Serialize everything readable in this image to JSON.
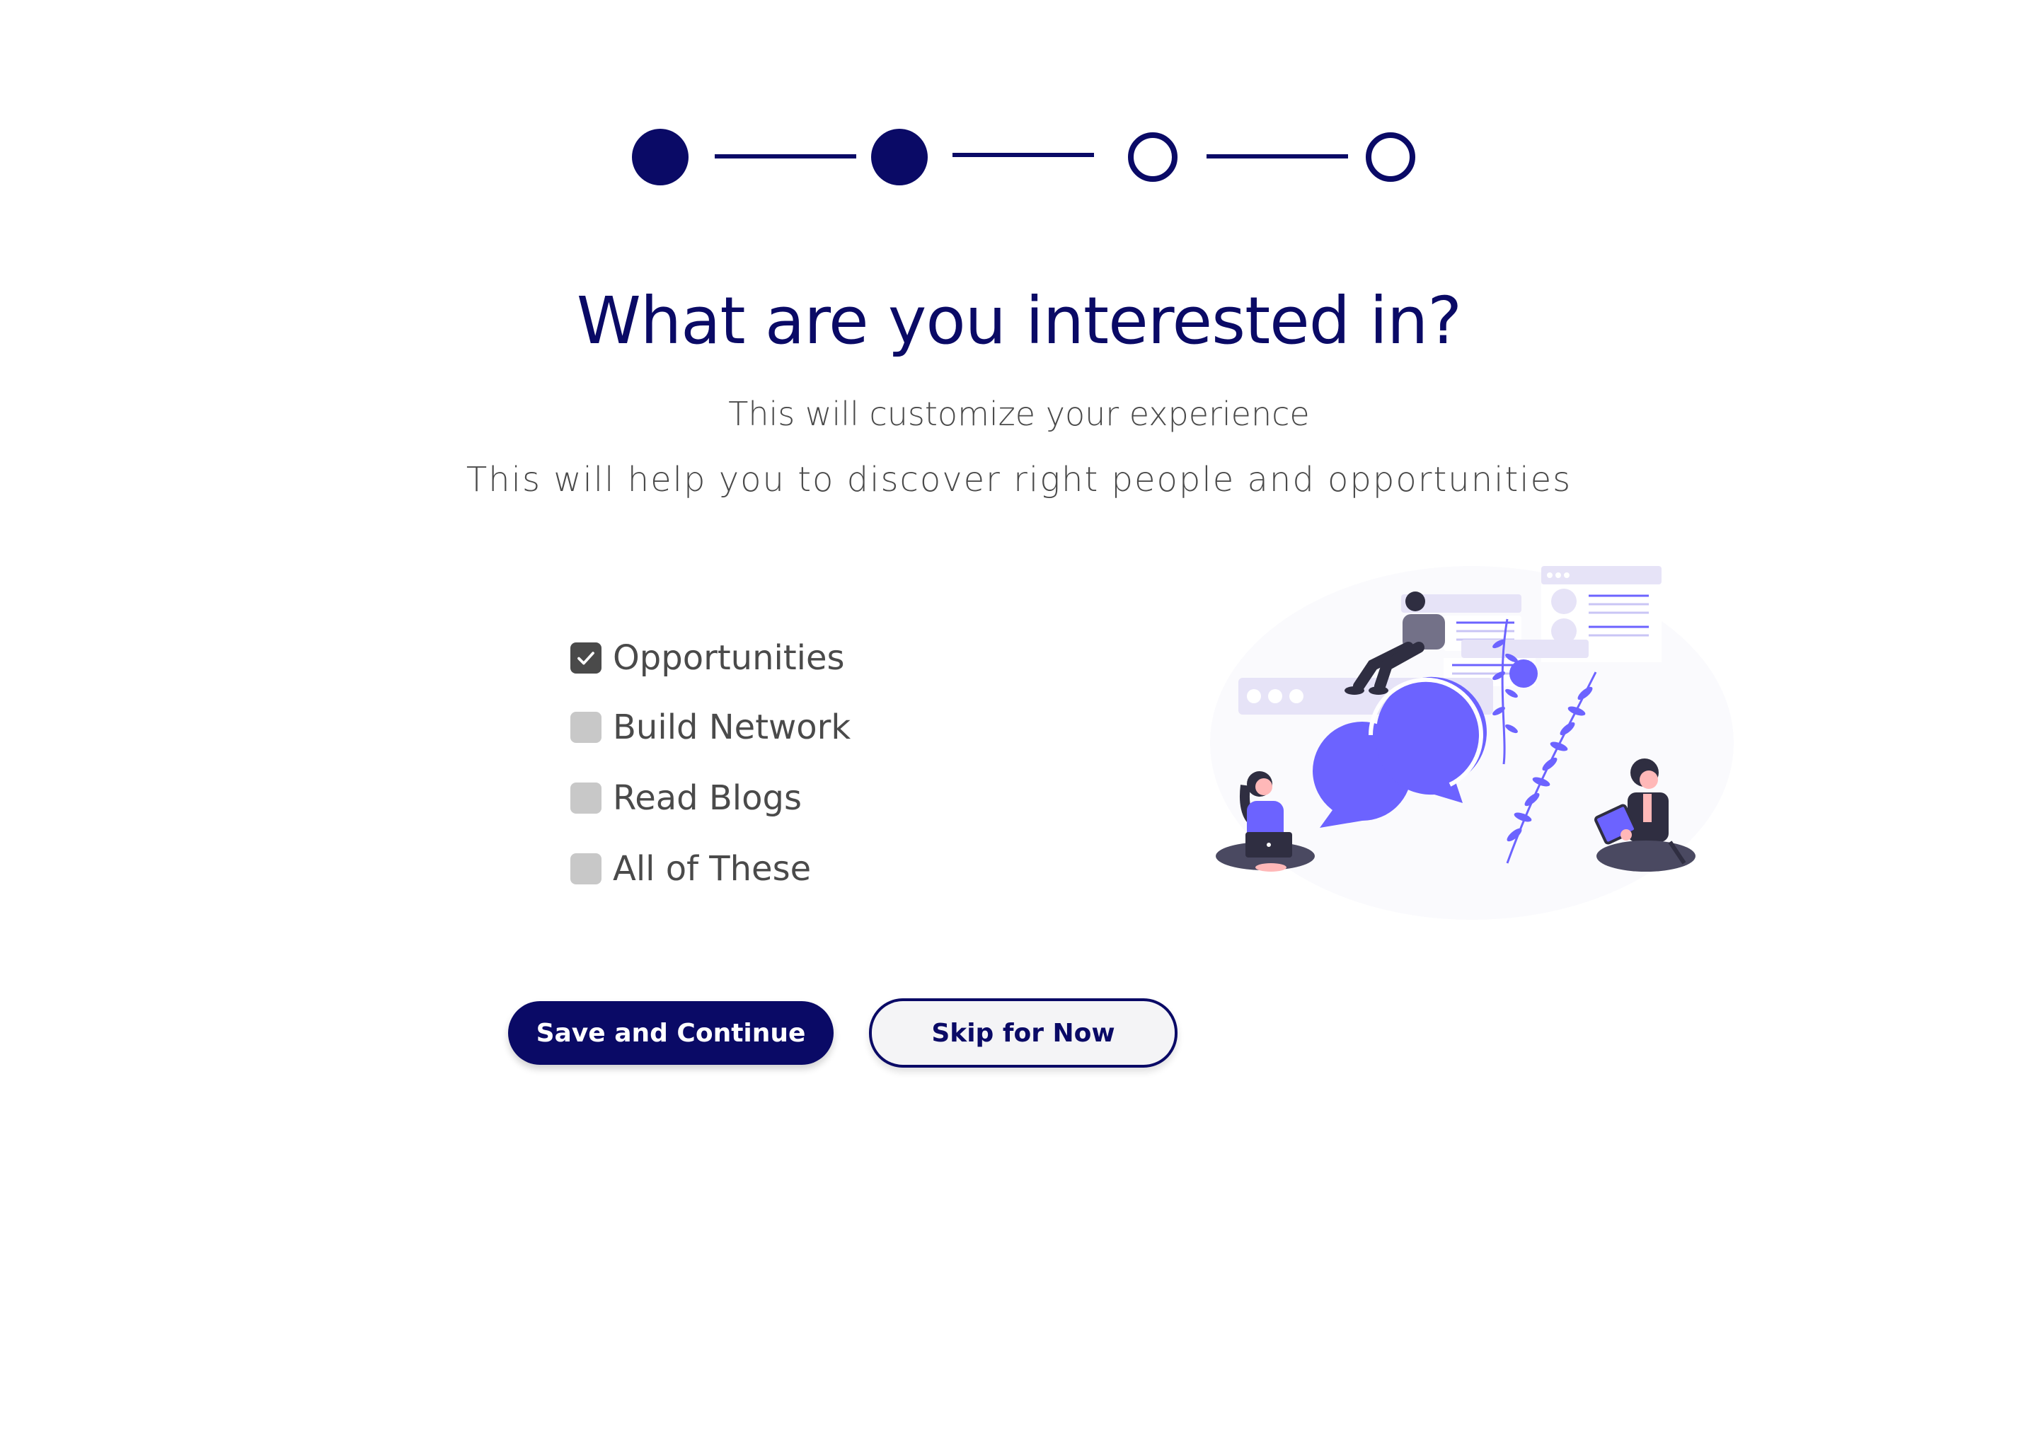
{
  "stepper": {
    "total_steps": 4,
    "completed_steps": 2
  },
  "header": {
    "title": "What are you interested in?",
    "subtitle": "This will customize your experience",
    "description": "This will help you to discover right people and opportunities"
  },
  "options": [
    {
      "label": "Opportunities",
      "checked": true
    },
    {
      "label": "Build Network",
      "checked": false
    },
    {
      "label": "Read Blogs",
      "checked": false
    },
    {
      "label": "All of These",
      "checked": false
    }
  ],
  "actions": {
    "primary_label": "Save and Continue",
    "secondary_label": "Skip for Now"
  },
  "colors": {
    "primary": "#0a0a66",
    "accent": "#6c63ff",
    "text": "#4a4a4a",
    "checkbox_unchecked": "#c8c8c8",
    "checkbox_checked": "#4a4a4a"
  }
}
